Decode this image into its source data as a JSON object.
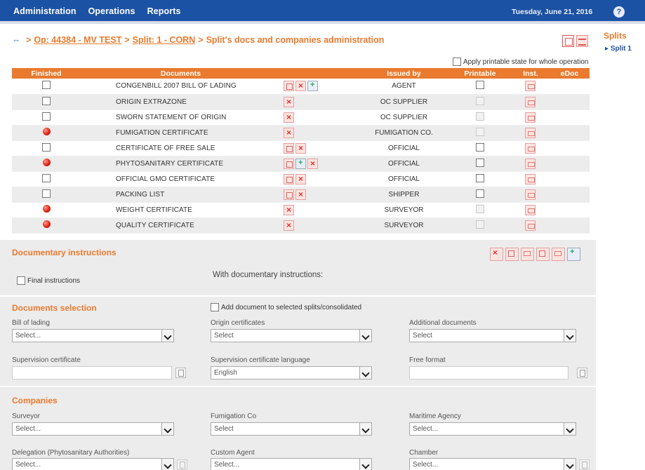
{
  "nav": {
    "items": [
      "Administration",
      "Operations",
      "Reports"
    ],
    "date": "Tuesday, June 21, 2016",
    "help": "?"
  },
  "breadcrumb": {
    "op": "Op: 44384 - MV TEST",
    "split": "Split: 1 - CORN",
    "current": "Split's docs and companies administration"
  },
  "sidepanel": {
    "title": "Splits",
    "item": "Split 1"
  },
  "apply_label": "Apply printable state for whole operation",
  "table": {
    "headers": [
      "Finished",
      "Documents",
      "Issued by",
      "Printable",
      "Inst.",
      "eDoc"
    ],
    "rows": [
      {
        "name": "CONGENBILL 2007 BILL OF LADING",
        "issued": "AGENT",
        "finished": false,
        "printable": true
      },
      {
        "name": "ORIGIN EXTRAZONE",
        "issued": "OC SUPPLIER",
        "finished": false,
        "printable": false
      },
      {
        "name": "SWORN STATEMENT OF ORIGIN",
        "issued": "OC SUPPLIER",
        "finished": false,
        "printable": false
      },
      {
        "name": "FUMIGATION CERTIFICATE",
        "issued": "FUMIGATION CO.",
        "finished": true,
        "printable": false
      },
      {
        "name": "CERTIFICATE OF FREE SALE",
        "issued": "OFFICIAL",
        "finished": false,
        "printable": true
      },
      {
        "name": "PHYTOSANITARY CERTIFICATE",
        "issued": "OFFICIAL",
        "finished": true,
        "printable": true
      },
      {
        "name": "OFFICIAL GMO CERTIFICATE",
        "issued": "OFFICIAL",
        "finished": false,
        "printable": true
      },
      {
        "name": "PACKING LIST",
        "issued": "SHIPPER",
        "finished": false,
        "printable": true
      },
      {
        "name": "WEIGHT CERTIFICATE",
        "issued": "SURVEYOR",
        "finished": true,
        "printable": false
      },
      {
        "name": "QUALITY CERTIFICATE",
        "issued": "SURVEYOR",
        "finished": true,
        "printable": false
      }
    ]
  },
  "instructions": {
    "title": "Documentary instructions",
    "final_label": "Final instructions",
    "with_label": "With documentary instructions:"
  },
  "docsel": {
    "title": "Documents selection",
    "add_label": "Add document to selected splits/consolidated",
    "bol_label": "Bill of lading",
    "bol_value": "Select...",
    "origin_label": "Origin certificates",
    "origin_value": "Select",
    "additional_label": "Additional documents",
    "additional_value": "Select",
    "supervision_label": "Supervision certificate",
    "lang_label": "Supervision certificate language",
    "lang_value": "English",
    "free_label": "Free format"
  },
  "companies": {
    "title": "Companies",
    "surveyor_label": "Surveyor",
    "surveyor_value": "Select...",
    "fumigation_label": "Fumigation Co",
    "fumigation_value": "Select",
    "maritime_label": "Maritime Agency",
    "maritime_value": "Select...",
    "delegation_label": "Delegation (Phytosanitary Authorities)",
    "delegation_value": "Select...",
    "custom_label": "Custom Agent",
    "custom_value": "Select...",
    "chamber_label": "Chamber",
    "chamber_value": "Select..."
  }
}
